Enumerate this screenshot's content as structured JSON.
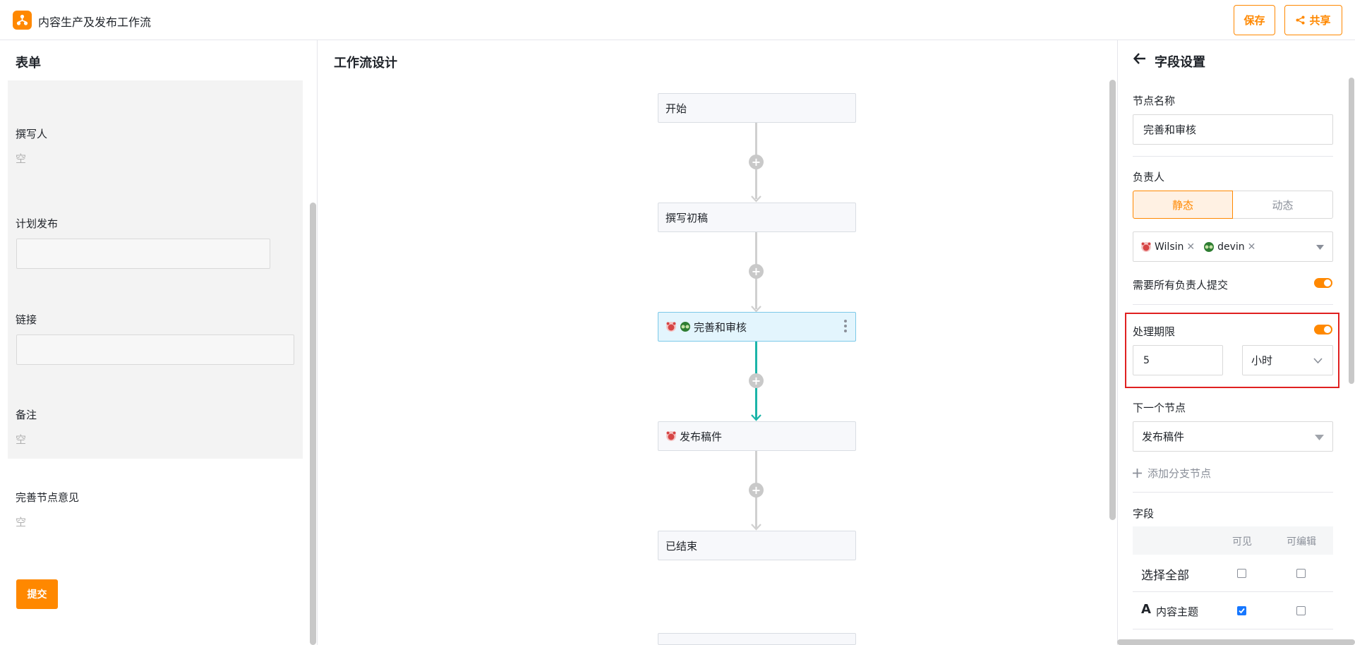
{
  "header": {
    "app_title": "内容生产及发布工作流",
    "save_label": "保存",
    "share_label": "共享"
  },
  "left": {
    "heading": "表单",
    "fields": [
      {
        "label": "撰写人",
        "value": "空"
      },
      {
        "label": "计划发布",
        "value": ""
      },
      {
        "label": "链接",
        "value": ""
      },
      {
        "label": "备注",
        "value": "空"
      },
      {
        "label": "完善节点意见",
        "value": "空"
      }
    ],
    "submit_label": "提交"
  },
  "center": {
    "heading": "工作流设计",
    "nodes": [
      {
        "label": "开始"
      },
      {
        "label": "撰写初稿"
      },
      {
        "label": "完善和审核"
      },
      {
        "label": "发布稿件"
      },
      {
        "label": "已结束"
      }
    ]
  },
  "right": {
    "heading": "字段设置",
    "node_name_label": "节点名称",
    "node_name_value": "完善和审核",
    "assignee_label": "负责人",
    "seg_static": "静态",
    "seg_dynamic": "动态",
    "assignees": [
      "Wilsin",
      "devin"
    ],
    "require_all_label": "需要所有负责人提交",
    "require_all_on": true,
    "deadline_label": "处理期限",
    "deadline_on": true,
    "deadline_value": "5",
    "deadline_unit": "小时",
    "next_node_label": "下一个节点",
    "next_node_value": "发布稿件",
    "add_branch_label": "添加分支节点",
    "fields_label": "字段",
    "col_visible": "可见",
    "col_editable": "可编辑",
    "rows": [
      {
        "label": "选择全部",
        "visible": false,
        "editable": false
      },
      {
        "label": "内容主题",
        "visible": true,
        "editable": false
      }
    ]
  },
  "colors": {
    "accent": "#ff8800",
    "teal": "#1bb4a8",
    "highlight_box": "#e02020"
  }
}
